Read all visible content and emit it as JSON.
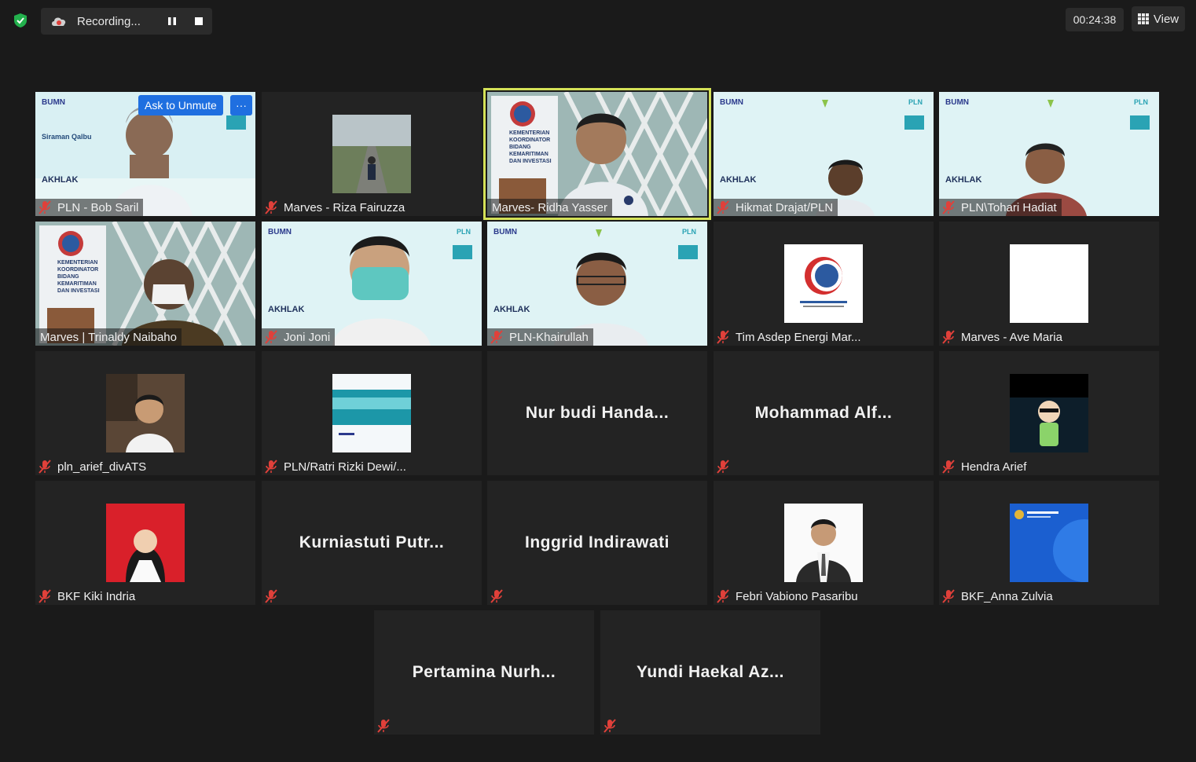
{
  "topbar": {
    "recording_label": "Recording...",
    "timer": "00:24:38",
    "view_label": "View"
  },
  "overlay": {
    "ask_unmute": "Ask to Unmute",
    "more": "···"
  },
  "brand_text": {
    "bumn": "BUMN",
    "akhlak": "AKHLAK",
    "pln": "PLN",
    "siraman": "Siraman Qalbu",
    "kementerian": "KEMENTERIAN KOORDINATOR BIDANG KEMARITIMAN DAN INVESTASI"
  },
  "participants": [
    {
      "name": "PLN - Bob Saril",
      "muted": true
    },
    {
      "name": "Marves - Riza Fairuzza",
      "muted": true
    },
    {
      "name": "Marves- Ridha Yasser",
      "muted": false
    },
    {
      "name": "Hikmat Drajat/PLN",
      "muted": true
    },
    {
      "name": "PLN\\Tohari Hadiat",
      "muted": true
    },
    {
      "name": "Marves | Trinaldy Naibaho",
      "muted": false
    },
    {
      "name": "Joni Joni",
      "muted": true
    },
    {
      "name": "PLN-Khairullah",
      "muted": true
    },
    {
      "name": "Tim Asdep Energi Mar...",
      "muted": true
    },
    {
      "name": "Marves - Ave Maria",
      "muted": true
    },
    {
      "name": "pln_arief_divATS",
      "muted": true
    },
    {
      "name": "PLN/Ratri Rizki Dewi/...",
      "muted": true
    },
    {
      "name": "Nur budi Handa...",
      "muted": false
    },
    {
      "name": "Mohammad  Alf...",
      "muted": true
    },
    {
      "name": "Hendra Arief",
      "muted": true
    },
    {
      "name": "BKF Kiki Indria",
      "muted": true
    },
    {
      "name": "Kurniastuti  Putr...",
      "muted": true
    },
    {
      "name": "Inggrid Indirawati",
      "muted": true
    },
    {
      "name": "Febri Vabiono Pasaribu",
      "muted": true
    },
    {
      "name": "BKF_Anna Zulvia",
      "muted": true
    },
    {
      "name": "Pertamina  Nurh...",
      "muted": true
    },
    {
      "name": "Yundi Haekal Az...",
      "muted": true
    }
  ],
  "colors": {
    "background": "#1a1a1a",
    "tile": "#232323",
    "active_speaker": "#d4e157",
    "muted_red": "#e0403a",
    "unmute_blue": "#1f6fe0"
  }
}
